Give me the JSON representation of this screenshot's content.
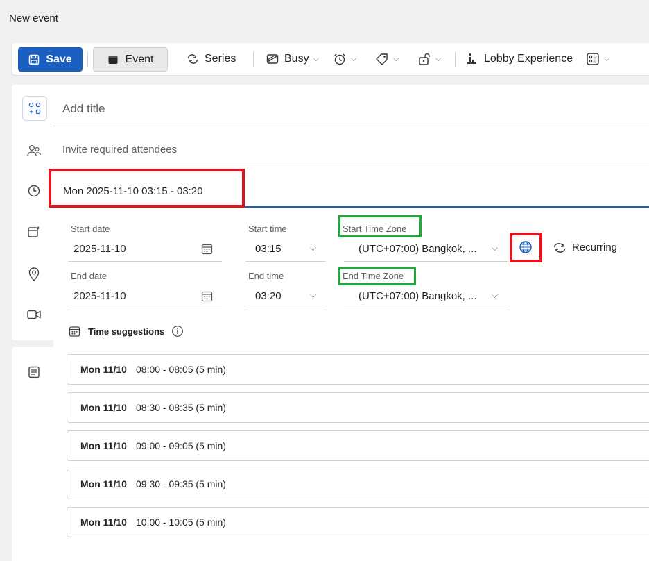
{
  "window": {
    "title": "New event"
  },
  "toolbar": {
    "save_label": "Save",
    "event_label": "Event",
    "series_label": "Series",
    "busy_label": "Busy",
    "lobby_label": "Lobby Experience"
  },
  "form": {
    "title_placeholder": "Add title",
    "attendees_placeholder": "Invite required attendees",
    "datetime_summary": "Mon 2025-11-10 03:15 - 03:20",
    "start_date_label": "Start date",
    "start_date_value": "2025-11-10",
    "start_time_label": "Start time",
    "start_time_value": "03:15",
    "start_tz_label": "Start Time Zone",
    "start_tz_value": "(UTC+07:00) Bangkok, ...",
    "end_date_label": "End date",
    "end_date_value": "2025-11-10",
    "end_time_label": "End time",
    "end_time_value": "03:20",
    "end_tz_label": "End Time Zone",
    "end_tz_value": "(UTC+07:00) Bangkok, ...",
    "recurring_label": "Recurring"
  },
  "suggestions": {
    "heading": "Time suggestions",
    "items": [
      {
        "date": "Mon 11/10",
        "time": "08:00 - 08:05 (5 min)"
      },
      {
        "date": "Mon 11/10",
        "time": "08:30 - 08:35 (5 min)"
      },
      {
        "date": "Mon 11/10",
        "time": "09:00 - 09:05 (5 min)"
      },
      {
        "date": "Mon 11/10",
        "time": "09:30 - 09:35 (5 min)"
      },
      {
        "date": "Mon 11/10",
        "time": "10:00 - 10:05 (5 min)"
      }
    ]
  },
  "colors": {
    "primary": "#1a5fbf",
    "highlight_red": "#e0141e",
    "highlight_green": "#1fa83a"
  }
}
